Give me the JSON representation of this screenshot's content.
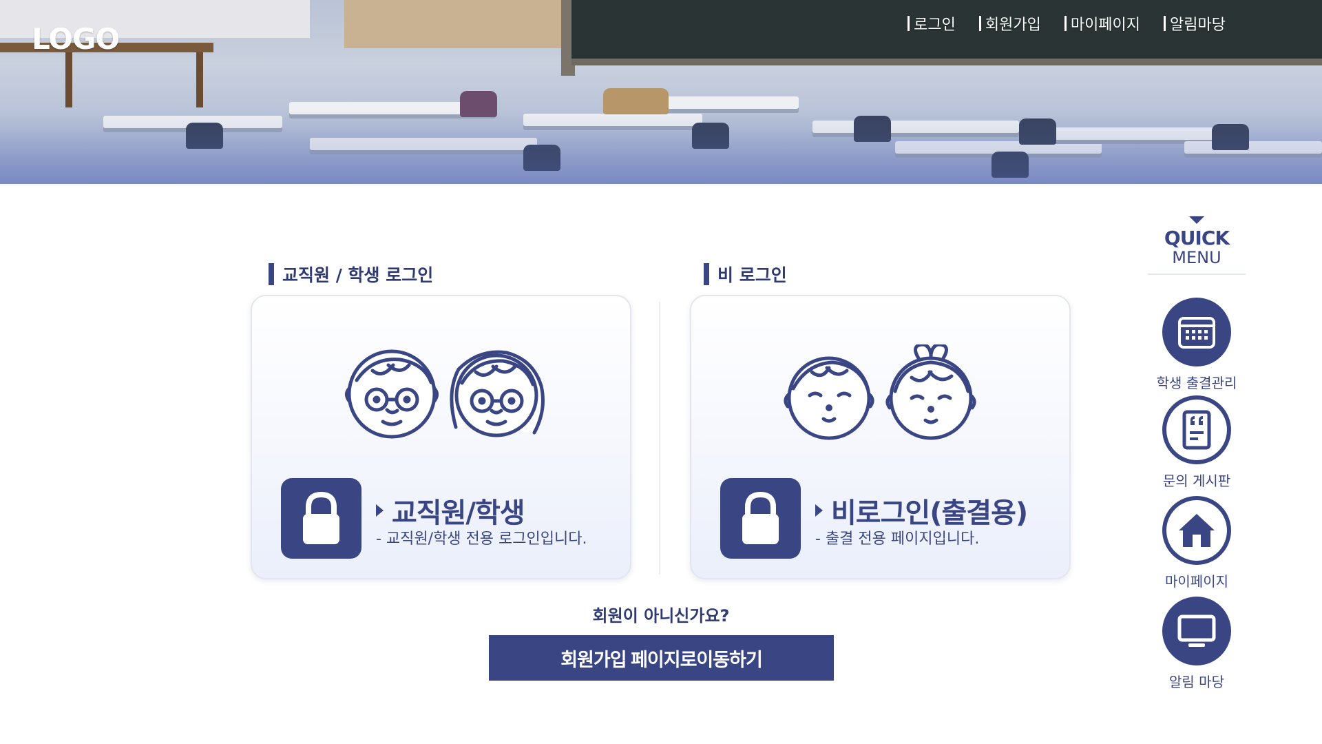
{
  "header": {
    "logo": "LOGO",
    "nav": [
      {
        "label": "로그인"
      },
      {
        "label": "회원가입"
      },
      {
        "label": "마이페이지"
      },
      {
        "label": "알림마당"
      }
    ]
  },
  "sections": {
    "staff": {
      "title": "교직원 / 학생 로그인",
      "cta_title": "교직원/학생",
      "cta_desc": "- 교직원/학생 전용 로그인입니다."
    },
    "guest": {
      "title": "비 로그인",
      "cta_title": "비로그인(출결용)",
      "cta_desc": "- 출결 전용 페이지입니다."
    }
  },
  "signup": {
    "prompt": "회원이 아니신가요?",
    "button_label": "회원가입 페이지로이동하기"
  },
  "quick_menu": {
    "title_line1": "QUICK",
    "title_line2": "MENU",
    "items": [
      {
        "label": "학생 출결관리",
        "icon": "calendar-icon"
      },
      {
        "label": "문의 게시판",
        "icon": "board-icon"
      },
      {
        "label": "마이페이지",
        "icon": "home-icon"
      },
      {
        "label": "알림 마당",
        "icon": "monitor-icon"
      }
    ]
  },
  "colors": {
    "brand": "#3a4683",
    "text": "#2f3a70",
    "card_border": "#e3e5ef"
  }
}
